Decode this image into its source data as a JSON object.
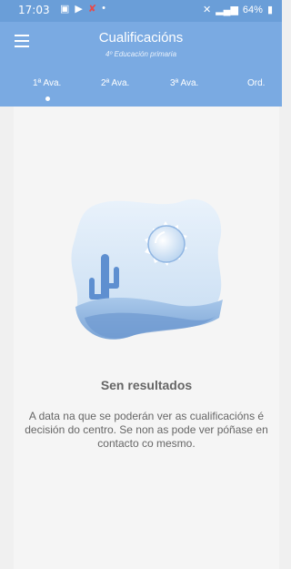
{
  "status_bar": {
    "time": "17:03",
    "battery": "64%"
  },
  "app_bar": {
    "title": "Cualificacións",
    "subtitle": "4º Educación primaria"
  },
  "tabs": [
    {
      "label": "1ª Ava."
    },
    {
      "label": "2ª Ava."
    },
    {
      "label": "3ª Ava."
    },
    {
      "label": "Ord."
    }
  ],
  "empty_state": {
    "title": "Sen resultados",
    "message": "A data na que se poderán ver as cualificacións é decisión do centro. Se non as pode ver póñase en contacto co mesmo."
  },
  "colors": {
    "primary": "#7aaae2",
    "statusbar": "#6a9ed8"
  }
}
